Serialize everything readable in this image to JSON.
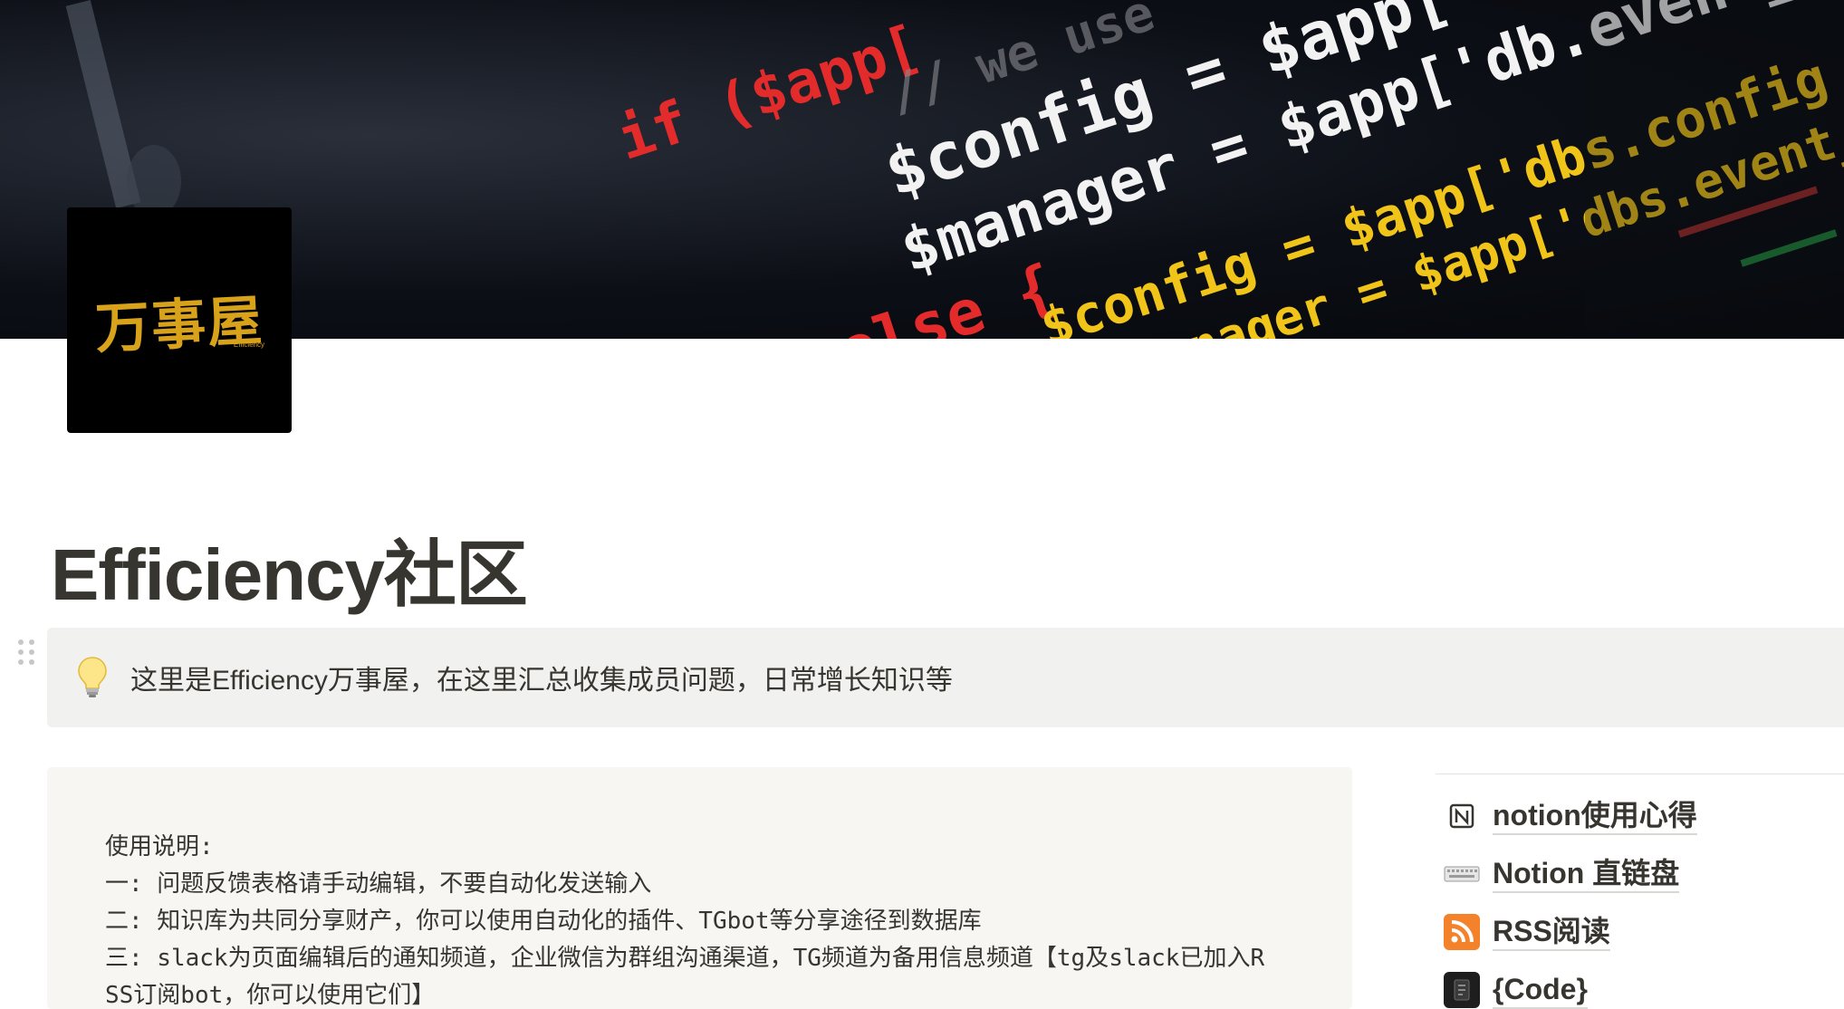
{
  "cover": {
    "code_lines": [
      "if ($app[",
      "// we use",
      "$config = $app['db.",
      "$manager = $app['db.event_",
      "else {",
      "$config = $app['dbs.config",
      "$manager = $app['dbs.event_manager"
    ]
  },
  "icon": {
    "logo_text": "万事屋",
    "logo_subtext": "Efficiency"
  },
  "page": {
    "title": "Efficiency社区"
  },
  "callout": {
    "icon": "lightbulb-icon",
    "text": "这里是Efficiency万事屋，在这里汇总收集成员问题，日常增长知识等"
  },
  "instructions": {
    "lines": [
      "使用说明:",
      "一: 问题反馈表格请手动编辑，不要自动化发送输入",
      "二: 知识库为共同分享财产，你可以使用自动化的插件、TGbot等分享途径到数据库",
      "三: slack为页面编辑后的通知频道，企业微信为群组沟通渠道，TG频道为备用信息频道【tg及slack已加入R",
      "SS订阅bot，你可以使用它们】"
    ]
  },
  "links": [
    {
      "icon": "notion-logo-icon",
      "label": "notion使用心得"
    },
    {
      "icon": "keyboard-icon",
      "label": "Notion 直链盘"
    },
    {
      "icon": "rss-icon",
      "label": "RSS阅读"
    },
    {
      "icon": "code-icon",
      "label": "{Code}"
    }
  ]
}
